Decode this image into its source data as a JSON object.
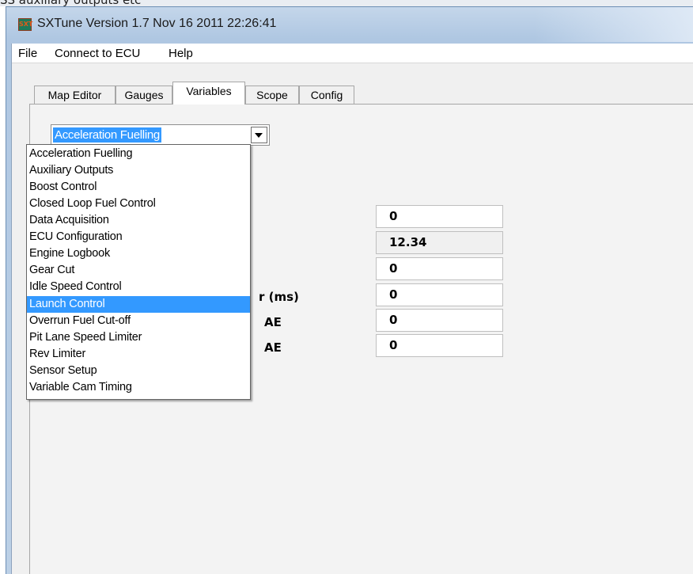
{
  "backdrop": {
    "text": "SS auxiliary outputs etc"
  },
  "window": {
    "title": "SXTune Version 1.7 Nov 16 2011 22:26:41",
    "icon_label": "SXT",
    "menu": {
      "file": "File",
      "connect": "Connect to ECU",
      "help": "Help"
    },
    "tabs": {
      "map_editor": "Map Editor",
      "gauges": "Gauges",
      "variables": "Variables",
      "scope": "Scope",
      "config": "Config"
    },
    "active_tab": "Variables"
  },
  "variables": {
    "category_selected": "Acceleration Fuelling",
    "categories": [
      "Acceleration Fuelling",
      "Auxiliary Outputs",
      "Boost Control",
      "Closed Loop Fuel Control",
      "Data Acquisition",
      "ECU Configuration",
      "Engine Logbook",
      "Gear Cut",
      "Idle Speed Control",
      "Launch Control",
      "Overrun Fuel Cut-off",
      "Pit Lane Speed Limiter",
      "Rev Limiter",
      "Sensor Setup",
      "Variable Cam Timing"
    ],
    "highlighted_category": "Launch Control",
    "visible_label_fragments": [
      "r (ms)",
      "AE",
      "AE"
    ],
    "values": [
      "0",
      "12.34",
      "0",
      "0",
      "0",
      "0"
    ]
  },
  "colors": {
    "selection": "#3399ff",
    "title_bar": "#b9cde5"
  }
}
